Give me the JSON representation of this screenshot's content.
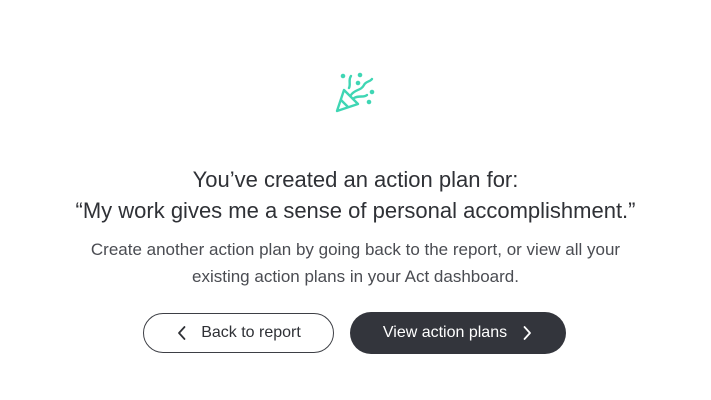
{
  "header": {
    "icon": "party-popper-icon",
    "accent_color": "#3fd6b4",
    "title_line1": "You’ve created an action plan for:",
    "title_line2": "“My work gives me a sense of personal accomplishment.”"
  },
  "body": {
    "description": "Create another action plan by going back to the report, or view all your existing action plans in your Act dashboard."
  },
  "actions": {
    "back_label": "Back to report",
    "back_icon": "chevron-left-icon",
    "view_label": "View action plans",
    "view_icon": "chevron-right-icon",
    "primary_color": "#33353c"
  }
}
